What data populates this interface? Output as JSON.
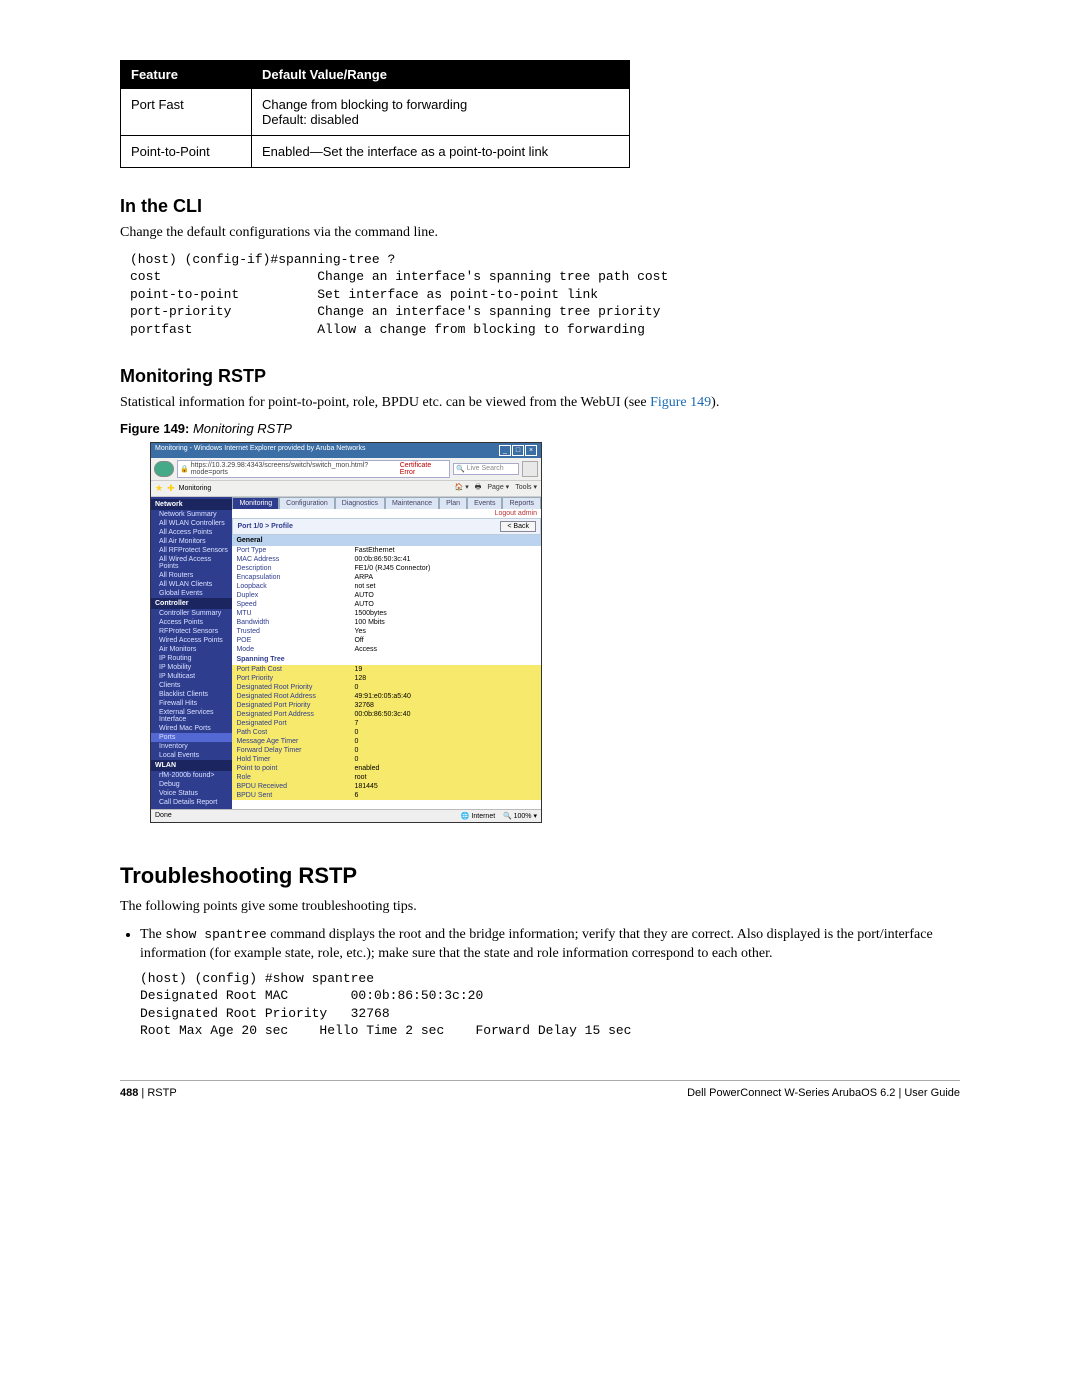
{
  "table": {
    "headers": [
      "Feature",
      "Default Value/Range"
    ],
    "rows": [
      {
        "feature": "Port Fast",
        "value": "Change from blocking to forwarding\nDefault: disabled"
      },
      {
        "feature": "Point-to-Point",
        "value": "Enabled—Set the interface as a point-to-point link"
      }
    ]
  },
  "cli_heading": "In the CLI",
  "cli_intro": "Change the default configurations via the command line.",
  "cli_block": "(host) (config-if)#spanning-tree ?\ncost                    Change an interface's spanning tree path cost\npoint-to-point          Set interface as point-to-point link\nport-priority           Change an interface's spanning tree priority\nportfast                Allow a change from blocking to forwarding",
  "monitor_heading": "Monitoring RSTP",
  "monitor_text_pre": "Statistical information for point-to-point, role, BPDU etc. can be viewed from the WebUI (see ",
  "monitor_link": "Figure 149",
  "monitor_text_post": ").",
  "figure_caption_bold": "Figure 149:",
  "figure_caption_ital": " Monitoring RSTP",
  "browser": {
    "title": "Monitoring - Windows Internet Explorer provided by Aruba Networks",
    "url": "https://10.3.29.98:4343/screens/switch/switch_mon.html?mode=ports",
    "cert": "Certificate Error",
    "search_placeholder": "Live Search",
    "fav_label": "Monitoring",
    "toolbar_items": [
      "Page",
      "Tools"
    ],
    "logout": "Logout admin",
    "tabs": [
      "Monitoring",
      "Configuration",
      "Diagnostics",
      "Maintenance",
      "Plan",
      "Events",
      "Reports"
    ],
    "breadcrumb": "Port 1/0 > Profile",
    "back_btn": "< Back",
    "sidebar": {
      "groups": [
        {
          "header": "Network",
          "items": [
            "Network Summary",
            "All WLAN Controllers",
            "All Access Points",
            "All Air Monitors",
            "All RFProtect Sensors",
            "All Wired Access Points",
            "All Routers",
            "All WLAN Clients",
            "Global Events"
          ]
        },
        {
          "header": "Controller",
          "items": [
            "Controller Summary",
            "Access Points",
            "RFProtect Sensors",
            "Wired Access Points",
            "Air Monitors",
            "IP Routing",
            "IP Mobility",
            "IP Multicast",
            "Clients",
            "Blacklist Clients",
            "Firewall Hits",
            "External Services Interface",
            "Wired Mac Ports",
            "Ports",
            "Inventory",
            "Local Events"
          ]
        },
        {
          "header": "WLAN",
          "items": [
            "rfM-2000b found>",
            "Debug",
            "Voice Status",
            "Call Details Report"
          ]
        }
      ]
    },
    "general_header": "General",
    "general_rows": [
      [
        "Port Type",
        "FastEthernet"
      ],
      [
        "MAC Address",
        "00:0b:86:50:3c:41"
      ],
      [
        "Description",
        "FE1/0 (RJ45 Connector)"
      ],
      [
        "Encapsulation",
        "ARPA"
      ],
      [
        "Loopback",
        "not set"
      ],
      [
        "Duplex",
        "AUTO"
      ],
      [
        "Speed",
        "AUTO"
      ],
      [
        "MTU",
        "1500bytes"
      ],
      [
        "Bandwidth",
        "100 Mbits"
      ],
      [
        "Trusted",
        "Yes"
      ],
      [
        "POE",
        "Off"
      ],
      [
        "Mode",
        "Access"
      ]
    ],
    "spanning_header": "Spanning Tree",
    "spanning_rows": [
      [
        "Port Path Cost",
        "19"
      ],
      [
        "Port Priority",
        "128"
      ],
      [
        "Designated Root Priority",
        "0"
      ],
      [
        "Designated Root Address",
        "49:91:e0:05:a5:40"
      ],
      [
        "Designated Port Priority",
        "32768"
      ],
      [
        "Designated Port Address",
        "00:0b:86:50:3c:40"
      ],
      [
        "Designated Port",
        "7"
      ],
      [
        "Path Cost",
        "0"
      ],
      [
        "Message Age Timer",
        "0"
      ],
      [
        "Forward Delay Timer",
        "0"
      ],
      [
        "Hold Timer",
        "0"
      ],
      [
        "Point to point",
        "enabled"
      ],
      [
        "Role",
        "root"
      ],
      [
        "BPDU Received",
        "181445"
      ],
      [
        "BPDU Sent",
        "6"
      ]
    ],
    "status_done": "Done",
    "status_internet": "Internet",
    "status_zoom": "100%"
  },
  "troubleshoot_heading": "Troubleshooting RSTP",
  "troubleshoot_intro": "The following points give some troubleshooting tips.",
  "bullet_pre": "The ",
  "bullet_cmd": "show spantree",
  "bullet_post": " command displays the root and the bridge information; verify that they are correct. Also displayed is the port/interface information (for example state, role, etc.); make sure that the state and role information correspond to each other.",
  "cli_block2": "(host) (config) #show spantree\nDesignated Root MAC        00:0b:86:50:3c:20\nDesignated Root Priority   32768\nRoot Max Age 20 sec    Hello Time 2 sec    Forward Delay 15 sec",
  "footer": {
    "page_num": "488",
    "section": "RSTP",
    "right": "Dell PowerConnect W-Series ArubaOS 6.2  |  User Guide"
  }
}
